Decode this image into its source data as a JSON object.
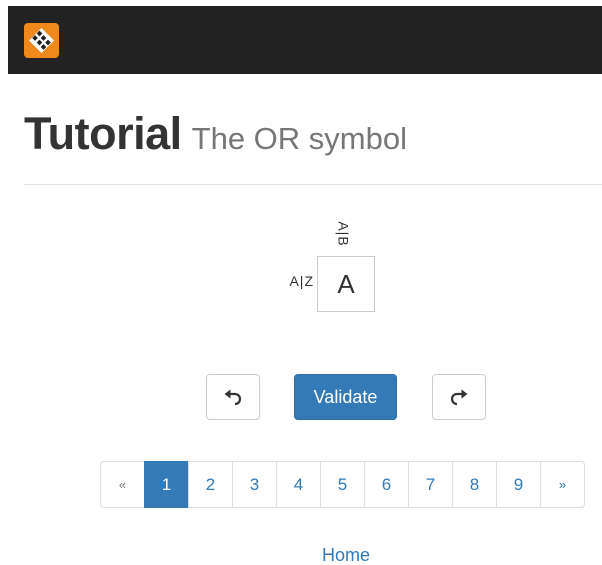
{
  "navbar": {
    "logo_icon": "puzzle-diamond-logo",
    "brand_color": "#f0891b"
  },
  "header": {
    "title": "Tutorial",
    "subtitle": "The OR symbol"
  },
  "puzzle": {
    "clue_top": "A|B",
    "clue_left": "A|Z",
    "cell_value": "A"
  },
  "controls": {
    "undo_icon": "undo-icon",
    "validate_label": "Validate",
    "redo_icon": "redo-icon",
    "accent_color": "#337ab7"
  },
  "pagination": {
    "prev_label": "«",
    "next_label": "»",
    "pages": [
      "1",
      "2",
      "3",
      "4",
      "5",
      "6",
      "7",
      "8",
      "9"
    ],
    "active_page": "1"
  },
  "footer": {
    "home_label": "Home"
  }
}
